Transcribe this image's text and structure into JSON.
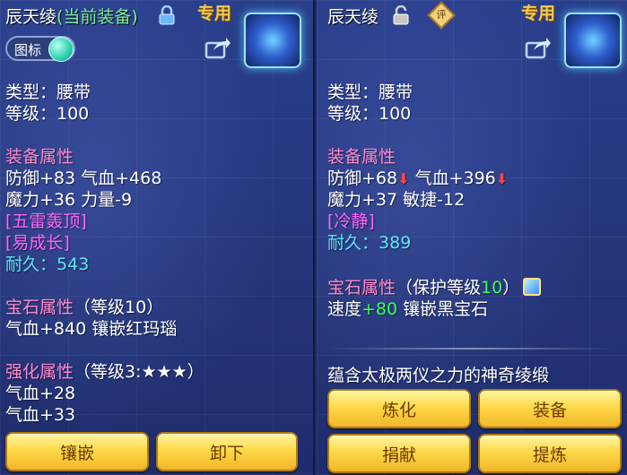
{
  "left": {
    "title_name": "辰天绫",
    "title_status": "(当前装备)",
    "special_tag": "专用",
    "toggle_label": "图标",
    "type_line": "类型：腰带",
    "level_line": "等级：100",
    "equip_attr_heading": "装备属性",
    "attr_line1": "防御+83 气血+468",
    "attr_line2": "魔力+36 力量-9",
    "effect1": "[五雷轰顶]",
    "effect2": "[易成长]",
    "durability_label": "耐久：",
    "durability_value": "543",
    "gem_heading": "宝石属性",
    "gem_level": "（等级10）",
    "gem_line": "气血+840 镶嵌红玛瑙",
    "enhance_heading": "强化属性",
    "enhance_level": "（等级3:★★★）",
    "enhance_line1": "气血+28",
    "enhance_line2": "气血+33",
    "btn_inlay": "镶嵌",
    "btn_unequip": "卸下"
  },
  "right": {
    "title_name": "辰天绫",
    "eval_label": "评",
    "special_tag": "专用",
    "type_line": "类型：腰带",
    "level_line": "等级：100",
    "equip_attr_heading": "装备属性",
    "attr_def": "防御+68",
    "attr_hp": "气血+396",
    "attr_line2": "魔力+37 敏捷-12",
    "effect1": "[冷静]",
    "durability_label": "耐久：",
    "durability_value": "389",
    "gem_heading": "宝石属性",
    "gem_level_prefix": "（保护等级",
    "gem_level_value": "10",
    "gem_level_suffix": "）",
    "gem_speed_label": "速度",
    "gem_speed_value": "+80",
    "gem_inlay": "镶嵌黑宝石",
    "description": "蕴含太极两仪之力的神奇绫缎",
    "btn_refine": "炼化",
    "btn_equip": "装备",
    "btn_donate": "捐献",
    "btn_extract": "提炼"
  },
  "icons": {
    "lock_closed": "lock-icon",
    "lock_open": "unlock-icon",
    "share": "share-icon",
    "item": "belt-item-icon",
    "down_arrow": "down-arrow-icon",
    "gem": "gem-icon"
  },
  "colors": {
    "heading": "#ff8ccf",
    "effect": "#ff66ff",
    "durability": "#5fe6ff",
    "highlight_green": "#3bff5a",
    "decrease_red": "#ff4646",
    "button_gold": "#ffd94a",
    "title_green": "#7cf0a0"
  }
}
